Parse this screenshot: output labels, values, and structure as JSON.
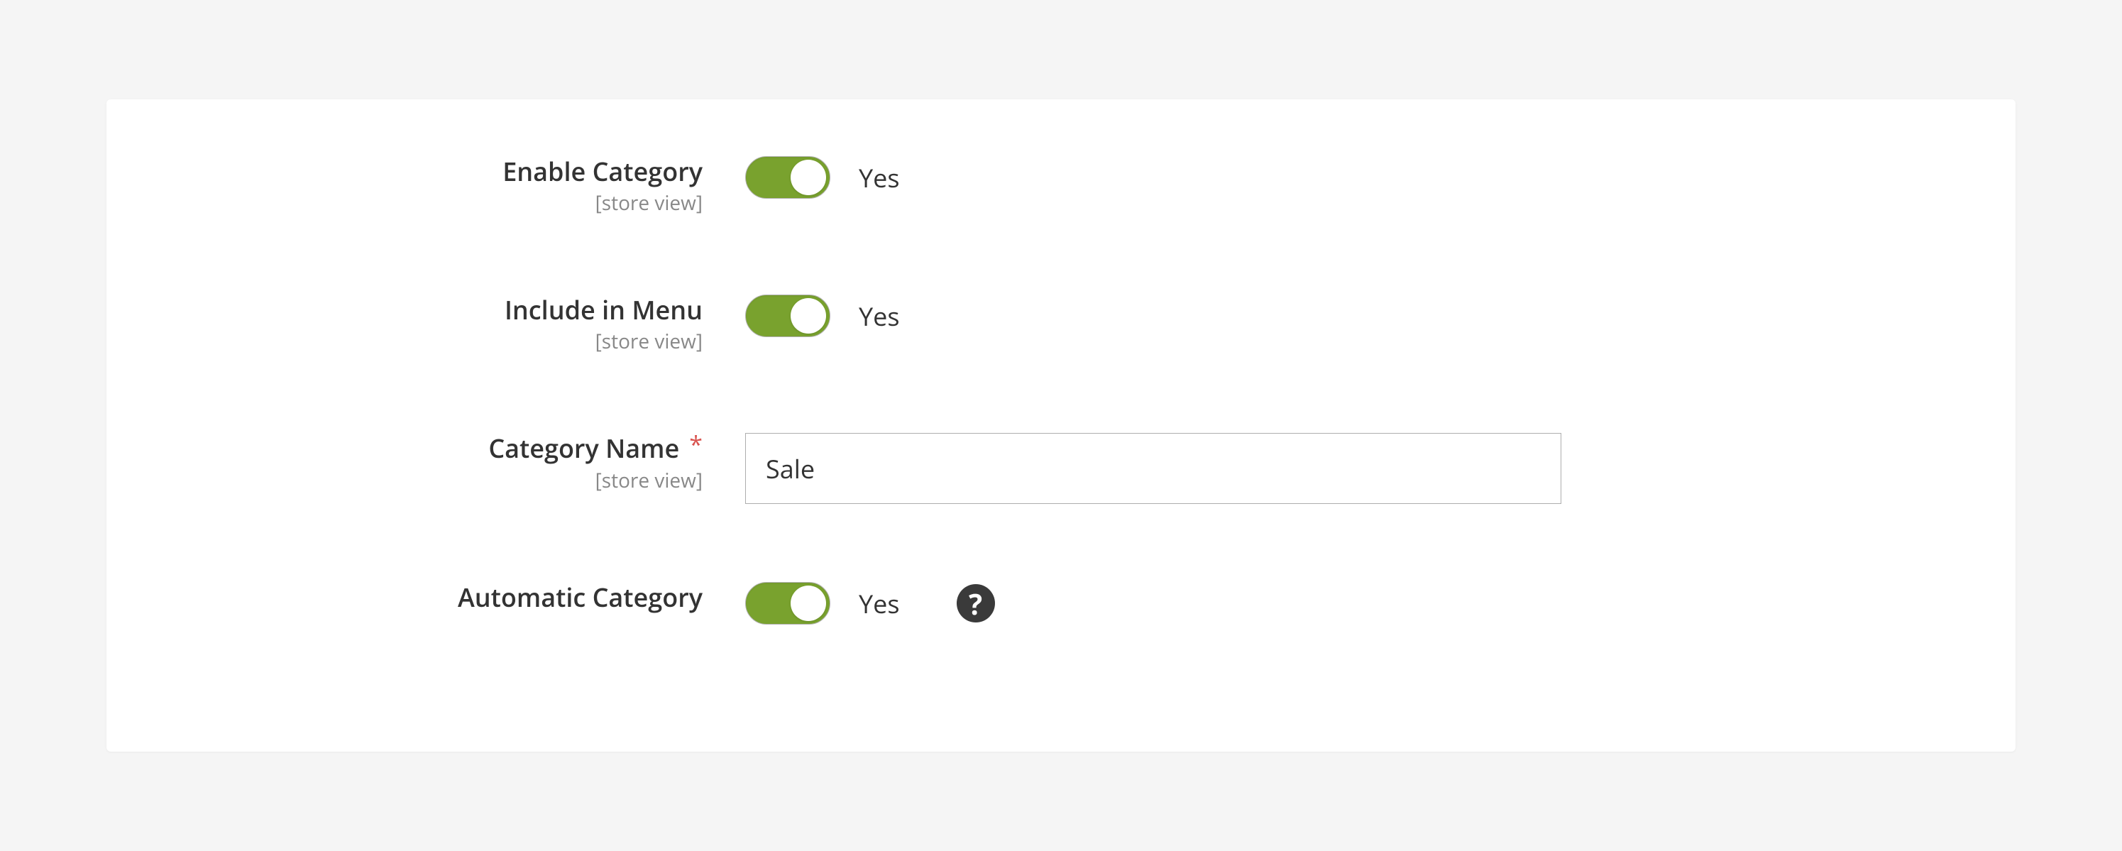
{
  "fields": {
    "enable_category": {
      "label": "Enable Category",
      "scope": "[store view]",
      "value_text": "Yes"
    },
    "include_in_menu": {
      "label": "Include in Menu",
      "scope": "[store view]",
      "value_text": "Yes"
    },
    "category_name": {
      "label": "Category Name",
      "scope": "[store view]",
      "required_mark": "*",
      "value": "Sale"
    },
    "automatic_category": {
      "label": "Automatic Category",
      "value_text": "Yes",
      "help": "?"
    }
  }
}
